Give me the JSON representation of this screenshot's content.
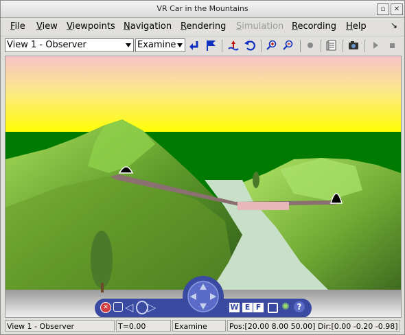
{
  "window": {
    "title": "VR Car in the Mountains"
  },
  "menu": [
    {
      "label": "File",
      "underline": "F",
      "rest": "ile",
      "enabled": true
    },
    {
      "label": "View",
      "underline": "V",
      "rest": "iew",
      "enabled": true
    },
    {
      "label": "Viewpoints",
      "underline": "V",
      "rest": "iewpoints",
      "enabled": true
    },
    {
      "label": "Navigation",
      "underline": "N",
      "rest": "avigation",
      "enabled": true
    },
    {
      "label": "Rendering",
      "underline": "R",
      "rest": "endering",
      "enabled": true
    },
    {
      "label": "Simulation",
      "underline": "S",
      "rest": "imulation",
      "enabled": false
    },
    {
      "label": "Recording",
      "underline": "R",
      "rest": "ecording",
      "enabled": true
    },
    {
      "label": "Help",
      "underline": "H",
      "rest": "elp",
      "enabled": true
    }
  ],
  "toolbar": {
    "viewpoint_select": "View 1 - Observer",
    "navigation_select": "Examine"
  },
  "statusbar": {
    "viewpoint": "View 1 - Observer",
    "time": "T=0.00",
    "mode": "Examine",
    "position_direction": "Pos:[20.00 8.00 50.00] Dir:[0.00 -0.20 -0.98]"
  },
  "navpanel": {
    "w_label": "W",
    "e_label": "E",
    "f_label": "F",
    "help_label": "?"
  },
  "colors": {
    "sky_top": "#f4c4c8",
    "sky_bottom": "#ffff00",
    "ground_far": "#007a00",
    "mountain": "#8fcf3a",
    "road": "#8a7070",
    "river": "#c8e0c8",
    "panel_blue": "#3a4aa0"
  }
}
